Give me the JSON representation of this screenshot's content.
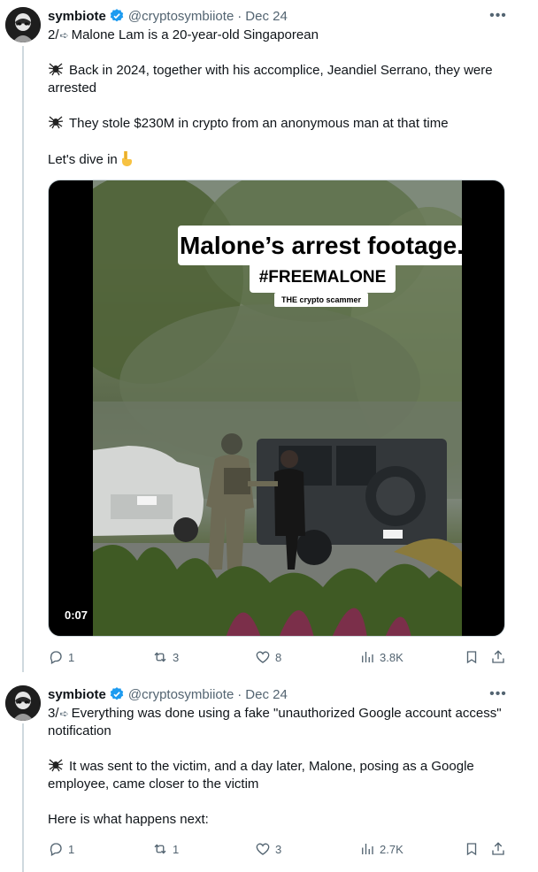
{
  "tweets": [
    {
      "name": "symbiote",
      "handle": "@cryptosymbiiote",
      "date": "Dec 24",
      "paragraphs": [
        "2/",
        "Malone Lam is a 20-year-old Singaporean",
        "Back in 2024, together with his accomplice, Jeandiel Serrano, they were arrested",
        "They stole $230M in crypto from an anonymous man at that time",
        "Let's dive in"
      ],
      "media": {
        "caption_title": "Malone’s arrest footage.",
        "caption_hashtag": "#FREEMALONE",
        "caption_sub": "THE crypto scammer",
        "timestamp": "0:07"
      },
      "stats": {
        "replies": "1",
        "reposts": "3",
        "likes": "8",
        "views": "3.8K"
      }
    },
    {
      "name": "symbiote",
      "handle": "@cryptosymbiiote",
      "date": "Dec 24",
      "paragraphs": [
        "3/",
        "Everything was done using a fake \"unauthorized Google account access\" notification",
        "It was sent to the victim, and a day later, Malone, posing as a Google employee, came closer to the victim",
        "Here is what happens next:"
      ],
      "stats": {
        "replies": "1",
        "reposts": "1",
        "likes": "3",
        "views": "2.7K"
      }
    }
  ],
  "icons": {
    "verified": "verified-badge-icon",
    "more": "more-icon",
    "reply": "reply-icon",
    "repost": "repost-icon",
    "like": "heart-icon",
    "views": "views-icon",
    "bookmark": "bookmark-icon",
    "share": "share-icon",
    "spider": "spider-emoji-icon",
    "pointing": "pointing-down-emoji-icon"
  },
  "colors": {
    "verified": "#1d9bf0",
    "secondary_text": "#536471",
    "thread_line": "#cfd9de"
  }
}
